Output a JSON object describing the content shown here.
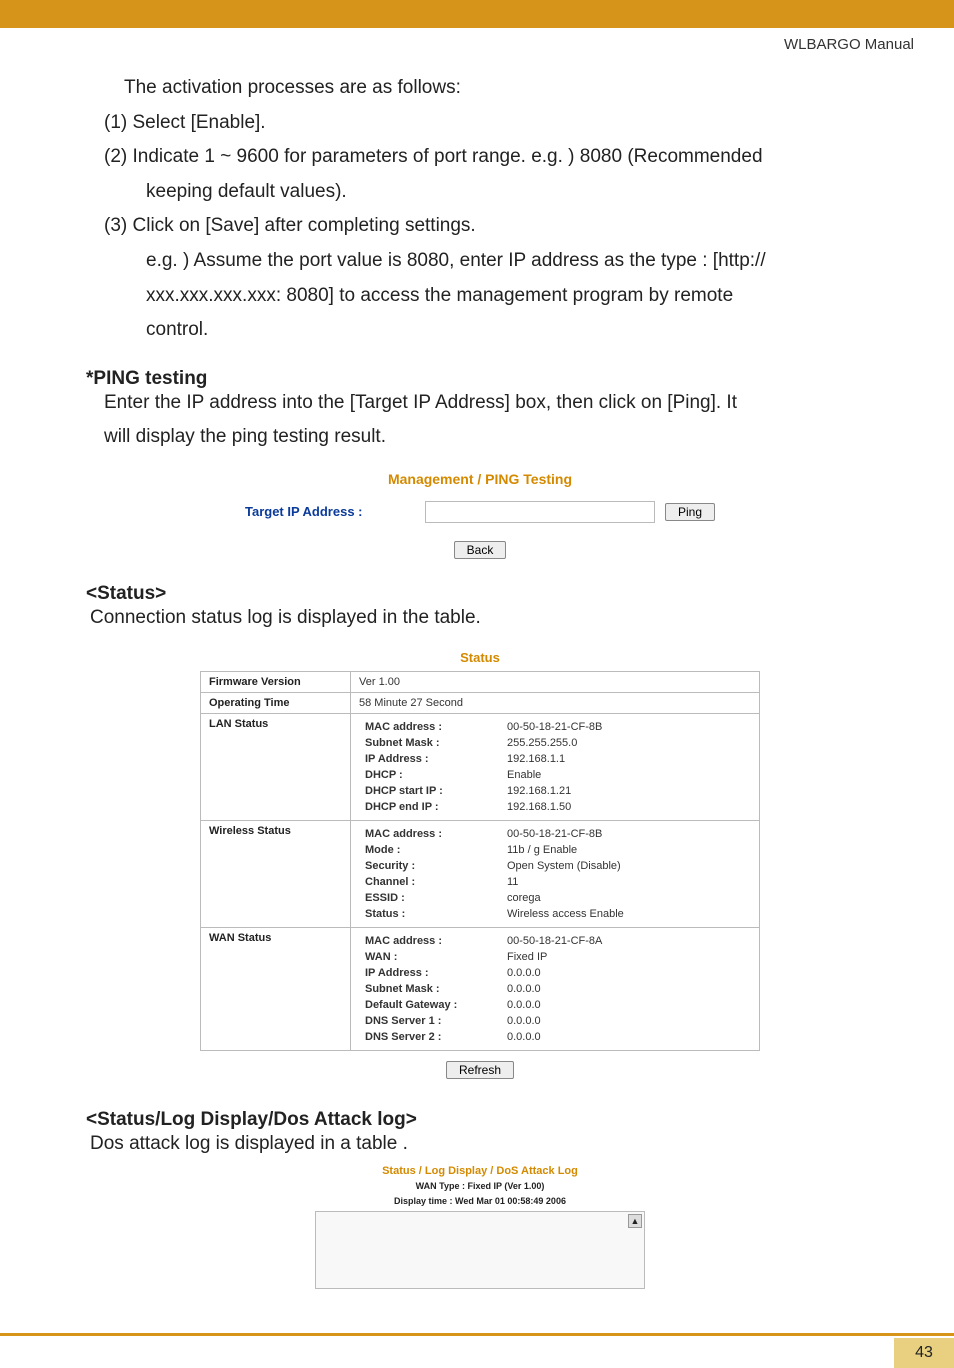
{
  "header": {
    "manual_name": "WLBARGO Manual"
  },
  "intro": "The activation processes are as follows:",
  "steps": {
    "s1": "(1) Select [Enable].",
    "s2a": "(2) Indicate 1 ~ 9600 for parameters of port range. e.g. ) 8080 (Recommended",
    "s2b": "keeping default values).",
    "s3": "(3) Click on [Save] after completing settings.",
    "s3b1": "e.g. ) Assume the port value is 8080, enter IP address as the type : [http://",
    "s3b2": "xxx.xxx.xxx.xxx: 8080] to access the management program by remote",
    "s3b3": "control."
  },
  "ping": {
    "heading": "*PING testing",
    "body1": "Enter the IP address into the [Target IP Address] box, then click on [Ping]. It",
    "body2": "will display the ping testing result.",
    "fig_title": "Management / PING Testing",
    "label": "Target IP Address :",
    "ping_btn": "Ping",
    "back_btn": "Back"
  },
  "status": {
    "heading": "<Status>",
    "body": "Connection status log is displayed in the table.",
    "fig_title": "Status",
    "rows": {
      "fw_label": "Firmware Version",
      "fw_value": "Ver 1.00",
      "op_label": "Operating Time",
      "op_value": "58 Minute 27 Second",
      "lan_label": "LAN Status",
      "lan": {
        "mac_l": "MAC address :",
        "mac_v": "00-50-18-21-CF-8B",
        "sub_l": "Subnet Mask :",
        "sub_v": "255.255.255.0",
        "ip_l": "IP Address :",
        "ip_v": "192.168.1.1",
        "dhcp_l": "DHCP :",
        "dhcp_v": "Enable",
        "ds_l": "DHCP start IP :",
        "ds_v": "192.168.1.21",
        "de_l": "DHCP end IP :",
        "de_v": "192.168.1.50"
      },
      "wl_label": "Wireless Status",
      "wl": {
        "mac_l": "MAC address :",
        "mac_v": "00-50-18-21-CF-8B",
        "mode_l": "Mode :",
        "mode_v": "11b / g Enable",
        "sec_l": "Security :",
        "sec_v": "Open System (Disable)",
        "ch_l": "Channel :",
        "ch_v": "11",
        "ess_l": "ESSID :",
        "ess_v": "corega",
        "st_l": "Status :",
        "st_v": "Wireless access Enable"
      },
      "wan_label": "WAN Status",
      "wan": {
        "mac_l": "MAC address :",
        "mac_v": "00-50-18-21-CF-8A",
        "wan_l": "WAN :",
        "wan_v": "Fixed IP",
        "ip_l": "IP Address :",
        "ip_v": "0.0.0.0",
        "sub_l": "Subnet Mask :",
        "sub_v": "0.0.0.0",
        "gw_l": "Default Gateway :",
        "gw_v": "0.0.0.0",
        "d1_l": "DNS Server 1 :",
        "d1_v": "0.0.0.0",
        "d2_l": "DNS Server 2 :",
        "d2_v": "0.0.0.0"
      }
    },
    "refresh_btn": "Refresh"
  },
  "dos": {
    "heading": "<Status/Log Display/Dos Attack log>",
    "body": "Dos attack log is displayed in a table .",
    "fig_title": "Status / Log Display / DoS Attack Log",
    "sub1": "WAN Type : Fixed IP (Ver 1.00)",
    "sub2": "Display time : Wed Mar 01 00:58:49 2006"
  },
  "footer": {
    "page": "43"
  }
}
